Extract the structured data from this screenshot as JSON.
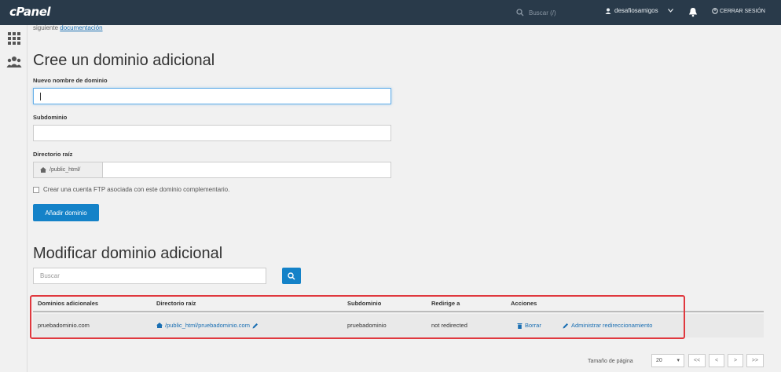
{
  "topbar": {
    "logo": "cPanel",
    "search_placeholder": "Buscar (/)",
    "username": "desafiosamigos",
    "logout_label": "CERRAR SESIÓN"
  },
  "breadcrumb": {
    "prefix": "siguiente",
    "link": "documentación"
  },
  "create": {
    "title": "Cree un dominio adicional",
    "domain_label": "Nuevo nombre de dominio",
    "domain_value": "",
    "subdomain_label": "Subdominio",
    "subdomain_value": "",
    "docroot_label": "Directorio raíz",
    "docroot_prefix": "/public_html/",
    "docroot_value": "",
    "ftp_checkbox_label": "Crear una cuenta FTP asociada con este dominio complementario.",
    "submit_label": "Añadir dominio"
  },
  "modify": {
    "title": "Modificar dominio adicional",
    "search_placeholder": "Buscar",
    "columns": [
      "Dominios adicionales",
      "Directorio raíz",
      "Subdominio",
      "Redirige a",
      "Acciones"
    ],
    "rows": [
      {
        "domain": "pruebadominio.com",
        "docroot": "/public_html/pruebadominio.com",
        "subdomain": "pruebadominio",
        "redirect": "not redirected",
        "delete_label": "Borrar",
        "manage_label": "Administrar redireccionamiento"
      }
    ]
  },
  "pagination": {
    "page_size_label": "Tamaño de página",
    "page_size": "20",
    "first": "<<",
    "prev": "<",
    "next": ">",
    "last": ">>"
  },
  "colors": {
    "topbar": "#293a4a",
    "primary": "#1482c8",
    "link": "#1a6fb3",
    "highlight": "#e0383e"
  }
}
